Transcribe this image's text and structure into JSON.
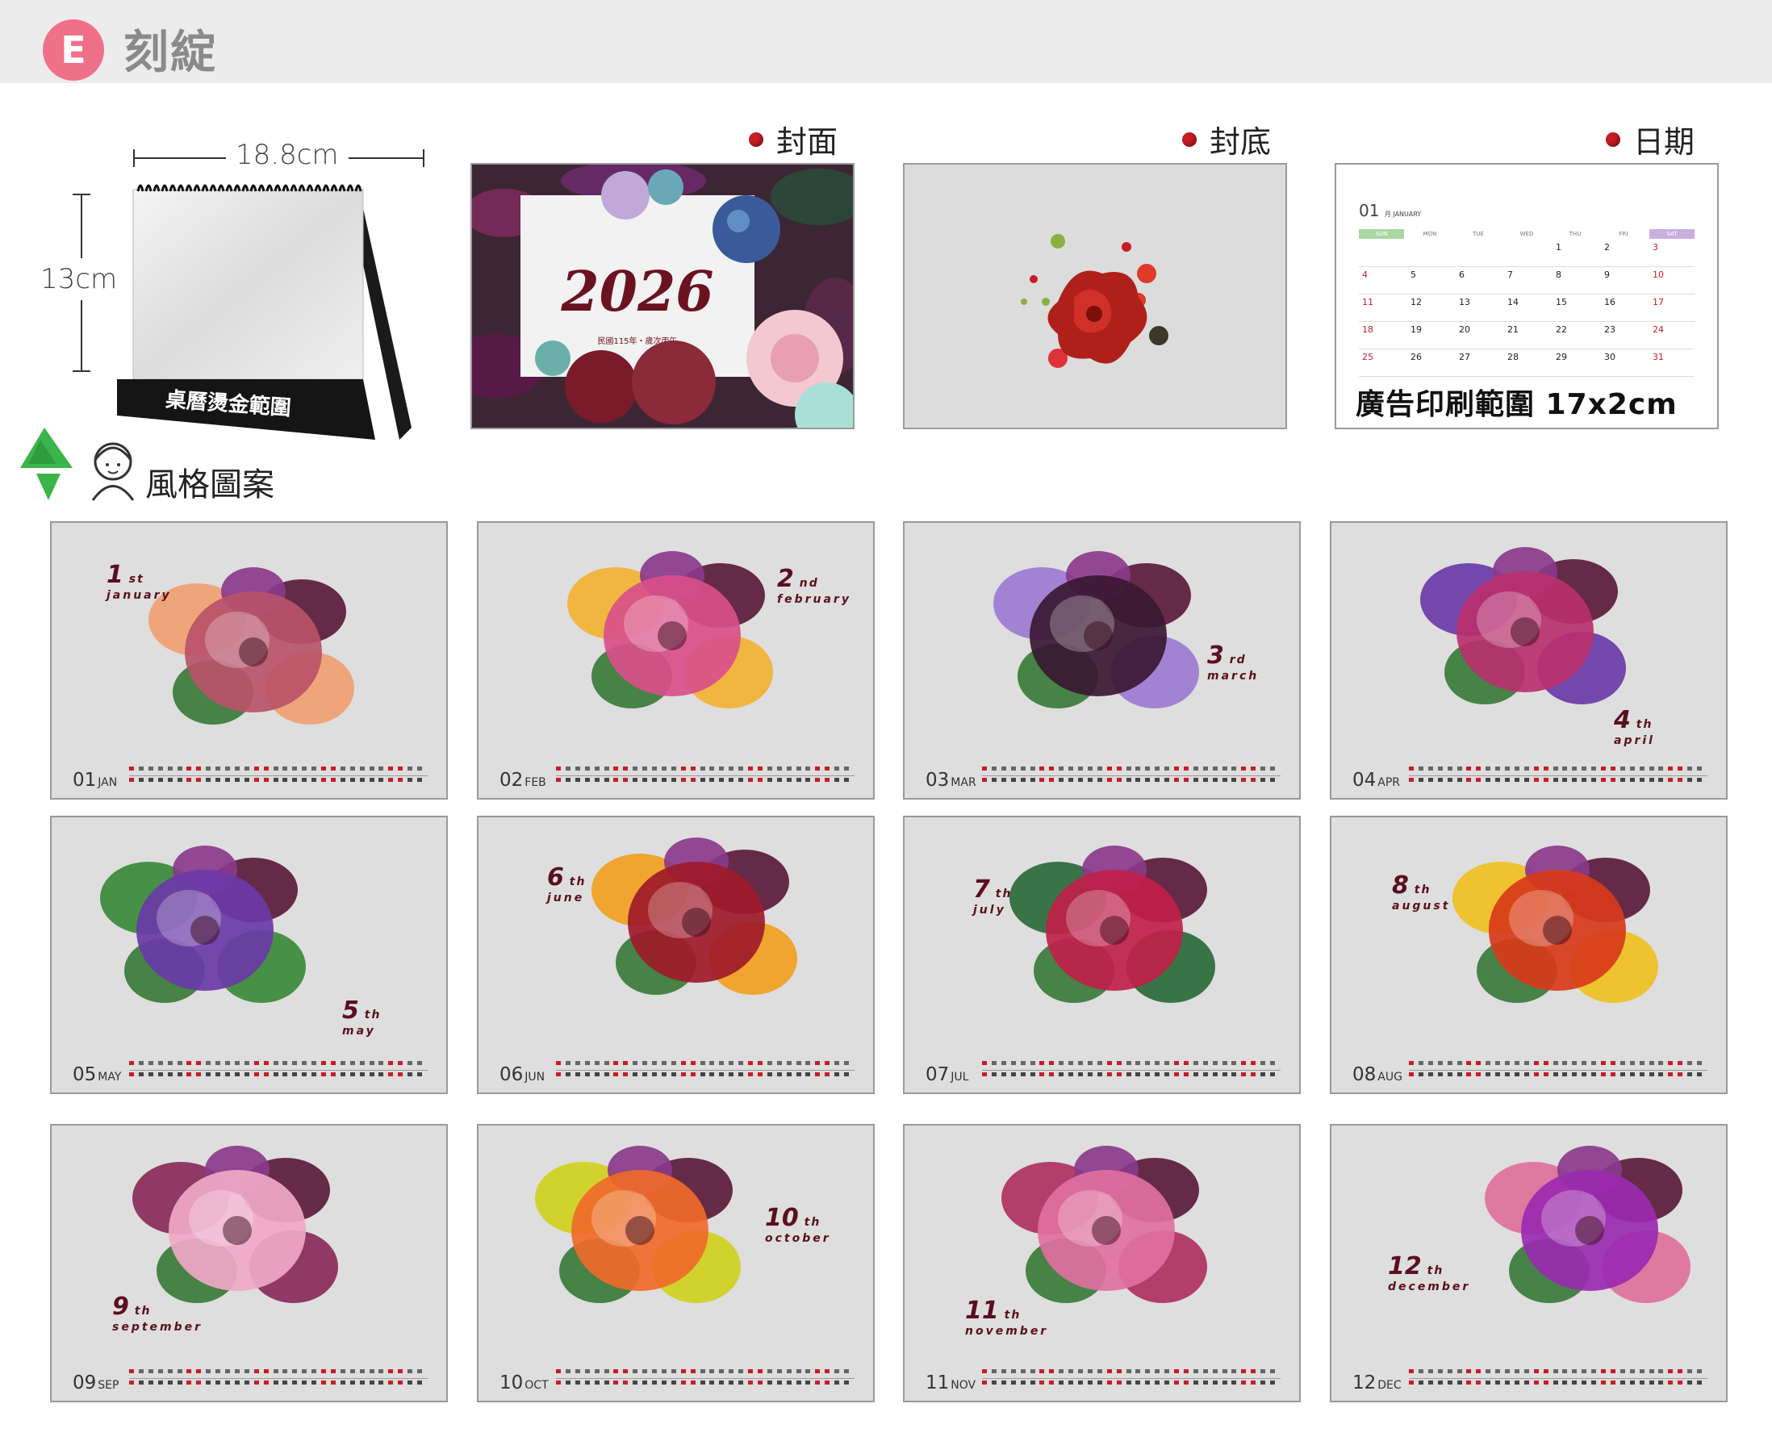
{
  "header": {
    "badge": "E",
    "title": "刻綻"
  },
  "desk_calendar": {
    "width_label": "18.8cm",
    "height_label": "13cm",
    "band_label": "桌曆燙金範圍"
  },
  "sections": {
    "cover_label": "封面",
    "back_label": "封底",
    "date_label": "日期"
  },
  "cover": {
    "year": "2026",
    "subtitle": "民國115年・歲次丙午"
  },
  "date_sample": {
    "month_number": "01",
    "month_word": "月 JANUARY",
    "weekdays": [
      "SUN",
      "MON",
      "TUE",
      "WED",
      "THU",
      "FRI",
      "SAT"
    ],
    "rows": [
      [
        "",
        "",
        "",
        "",
        "1",
        "2",
        "3"
      ],
      [
        "4",
        "5",
        "6",
        "7",
        "8",
        "9",
        "10"
      ],
      [
        "11",
        "12",
        "13",
        "14",
        "15",
        "16",
        "17"
      ],
      [
        "18",
        "19",
        "20",
        "21",
        "22",
        "23",
        "24"
      ],
      [
        "25",
        "26",
        "27",
        "28",
        "29",
        "30",
        "31"
      ]
    ],
    "ad_text": "廣告印刷範圍 17x2cm"
  },
  "style_label": "風格圖案",
  "months": [
    {
      "num": "1",
      "suffix": "st",
      "name": "january",
      "code": "01",
      "abbr": "JAN",
      "color": "#b8536a",
      "accent": "#f0a070"
    },
    {
      "num": "2",
      "suffix": "nd",
      "name": "february",
      "code": "02",
      "abbr": "FEB",
      "color": "#d94f8a",
      "accent": "#f2b233"
    },
    {
      "num": "3",
      "suffix": "rd",
      "name": "march",
      "code": "03",
      "abbr": "MAR",
      "color": "#3a1832",
      "accent": "#9c7ad0"
    },
    {
      "num": "4",
      "suffix": "th",
      "name": "april",
      "code": "04",
      "abbr": "APR",
      "color": "#b8306e",
      "accent": "#6a3aa8"
    },
    {
      "num": "5",
      "suffix": "th",
      "name": "may",
      "code": "05",
      "abbr": "MAY",
      "color": "#6a3aa8",
      "accent": "#3a8a3a"
    },
    {
      "num": "6",
      "suffix": "th",
      "name": "june",
      "code": "06",
      "abbr": "JUN",
      "color": "#a01a2a",
      "accent": "#f0a020"
    },
    {
      "num": "7",
      "suffix": "th",
      "name": "july",
      "code": "07",
      "abbr": "JUL",
      "color": "#c0204a",
      "accent": "#2a6a3a"
    },
    {
      "num": "8",
      "suffix": "th",
      "name": "august",
      "code": "08",
      "abbr": "AUG",
      "color": "#d83a1a",
      "accent": "#f0c020"
    },
    {
      "num": "9",
      "suffix": "th",
      "name": "september",
      "code": "09",
      "abbr": "SEP",
      "color": "#f0a8c8",
      "accent": "#8a2a5a"
    },
    {
      "num": "10",
      "suffix": "th",
      "name": "october",
      "code": "10",
      "abbr": "OCT",
      "color": "#f06a2a",
      "accent": "#d0d020"
    },
    {
      "num": "11",
      "suffix": "th",
      "name": "november",
      "code": "11",
      "abbr": "NOV",
      "color": "#e070a0",
      "accent": "#b03060"
    },
    {
      "num": "12",
      "suffix": "th",
      "name": "december",
      "code": "12",
      "abbr": "DEC",
      "color": "#9a2ab0",
      "accent": "#e0709a"
    }
  ]
}
